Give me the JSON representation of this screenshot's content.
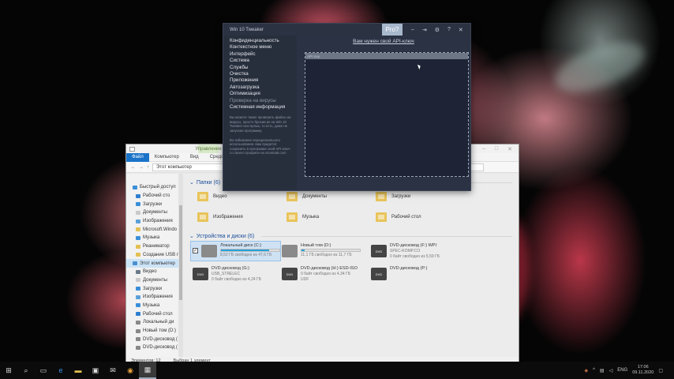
{
  "explorer": {
    "ribbon_manage": "Управление",
    "tabs": [
      "Файл",
      "Компьютер",
      "Вид",
      "Средства работы"
    ],
    "address": "Этот компьютер",
    "nav": [
      {
        "label": "Быстрый доступ",
        "pin": false,
        "color": "#3b8fd8"
      },
      {
        "label": "Рабочий сто",
        "pin": true,
        "color": "#2f7fd0"
      },
      {
        "label": "Загрузки",
        "pin": true,
        "color": "#3b8fd8"
      },
      {
        "label": "Документы",
        "pin": true,
        "color": "#c9c9c9"
      },
      {
        "label": "Изображения",
        "pin": true,
        "color": "#5aa0d8"
      },
      {
        "label": "Microsoft.Windo",
        "pin": true,
        "color": "#e3c052"
      },
      {
        "label": "Музыка",
        "pin": true,
        "color": "#3b8fd8"
      },
      {
        "label": "Реаниматор",
        "pin": true,
        "color": "#e3c052"
      },
      {
        "label": "Создание USB п",
        "pin": true,
        "color": "#e3c052"
      },
      {
        "label": "Этот компьютер",
        "pin": false,
        "color": "#4a90d0",
        "selected": true
      },
      {
        "label": "Видео",
        "pin": true,
        "color": "#6b7a8a"
      },
      {
        "label": "Документы",
        "pin": true,
        "color": "#c9c9c9"
      },
      {
        "label": "Загрузки",
        "pin": true,
        "color": "#3b8fd8"
      },
      {
        "label": "Изображения",
        "pin": true,
        "color": "#5aa0d8"
      },
      {
        "label": "Музыка",
        "pin": true,
        "color": "#3b8fd8"
      },
      {
        "label": "Рабочий стол",
        "pin": true,
        "color": "#2f7fd0"
      },
      {
        "label": "Локальный ди",
        "pin": true,
        "color": "#888"
      },
      {
        "label": "Новый том (D:)",
        "pin": true,
        "color": "#888"
      },
      {
        "label": "DVD-дисковод (",
        "pin": true,
        "color": "#888"
      },
      {
        "label": "DVD-дисковод (",
        "pin": true,
        "color": "#888"
      }
    ],
    "folders_group": "Папки (6)",
    "folders": [
      "Видео",
      "Документы",
      "Загрузки",
      "Изображения",
      "Музыка",
      "Рабочий стол"
    ],
    "drives_group": "Устройства и диски (6)",
    "drives": [
      {
        "name": "Локальный диск (C:)",
        "free": "8,52 ГБ свободно из 47,6 ГБ",
        "used_fraction": 0.82,
        "kind": "hdd",
        "selected": true
      },
      {
        "name": "Новый том (D:)",
        "free": "11,1 ГБ свободно из 11,7 ГБ",
        "used_fraction": 0.05,
        "kind": "hdd"
      },
      {
        "name": "DVD-дисковод (F:) WPI",
        "free": "SPEC-KOMP.CO",
        "kind": "dvd",
        "label2": "0 байт свободно из 5,59 ГБ"
      },
      {
        "name": "DVD-дисковод (G:)",
        "free": "USB_STRELEC",
        "label2": "0 байт свободно из 4,24 ГБ",
        "kind": "dvd"
      },
      {
        "name": "DVD-дисковод (H:) ESD-ISO",
        "free": "0 байт свободно из 4,34 ГБ",
        "label2": "UDF",
        "kind": "dvd"
      },
      {
        "name": "DVD-дисковод (P:)",
        "free": "",
        "kind": "dvd"
      }
    ],
    "status_count": "Элементов: 12",
    "status_selected": "Выбран 1 элемент"
  },
  "tweaker": {
    "title": "Win 10 Tweaker",
    "pro": "Pro?",
    "menu": [
      {
        "label": "Конфиденциальность",
        "dim": false
      },
      {
        "label": "Контекстное меню",
        "dim": false
      },
      {
        "label": "Интерфейс",
        "dim": false
      },
      {
        "label": "Система",
        "dim": false
      },
      {
        "label": "Службы",
        "dim": false
      },
      {
        "label": "Очистка",
        "dim": false
      },
      {
        "label": "Приложения",
        "dim": false
      },
      {
        "label": "Автозагрузка",
        "dim": false
      },
      {
        "label": "Оптимизация",
        "dim": false
      },
      {
        "label": "Проверка на вирусы",
        "dim": true
      },
      {
        "label": "Системная информация",
        "dim": false
      }
    ],
    "note1": "Вы можете также проверить файлы на вирусы, просто бросив их на Win 10 Tweaker или ярлык, то есть, даже не запуская программу.",
    "note2": "Во избежание нерационального использования, вам придется сохранить в программе свой API-ключ со своего профиля на virustotal.com",
    "link": "Вам нужен свой API-ключ",
    "api_placeholder": "API Key"
  },
  "taskbar": {
    "lang": "ENG",
    "time": "17:06",
    "date": "09.11.2020"
  }
}
